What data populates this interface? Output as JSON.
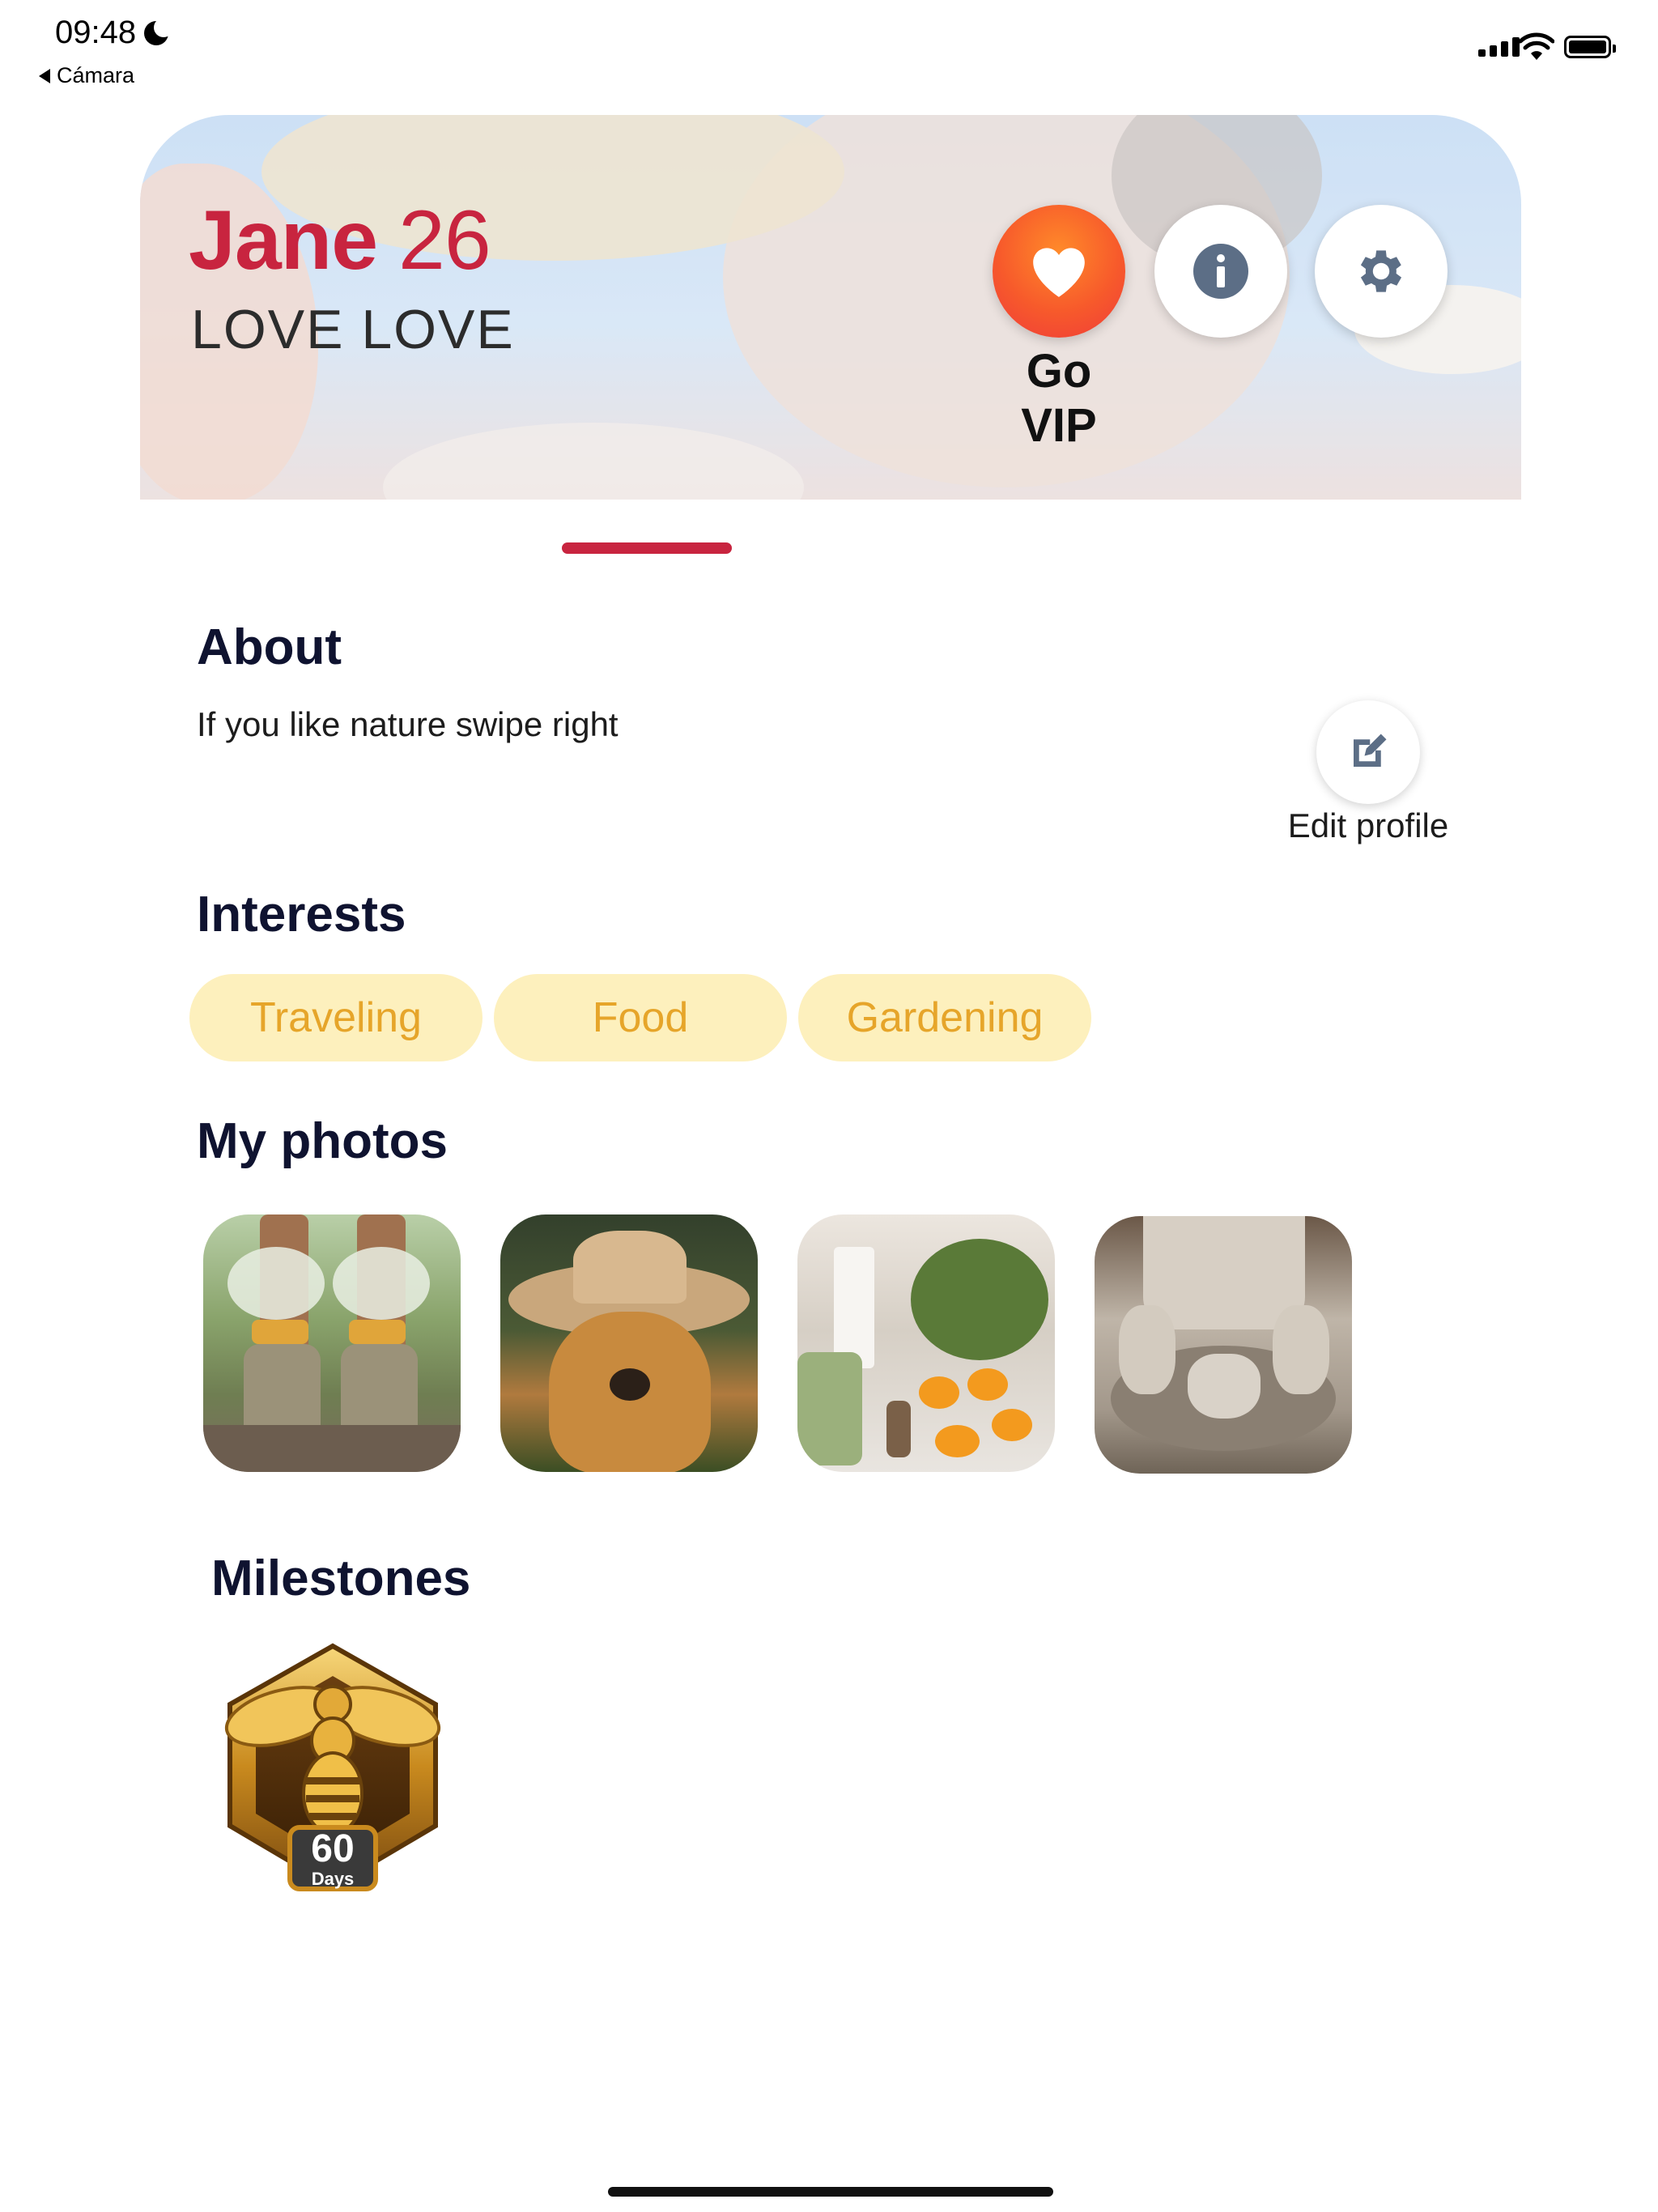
{
  "status_bar": {
    "time": "09:48",
    "back_app": "Cámara"
  },
  "profile": {
    "first_name": "Jane",
    "age": "26",
    "tagline": "LOVE LOVE"
  },
  "actions": {
    "vip_label": "Go VIP",
    "info_icon": "info-icon",
    "settings_icon": "gear-icon"
  },
  "about": {
    "title": "About",
    "text": "If you like nature swipe right",
    "edit_label": "Edit profile"
  },
  "interests": {
    "title": "Interests",
    "items": [
      "Traveling",
      "Food",
      "Gardening"
    ]
  },
  "photos": {
    "title": "My photos"
  },
  "milestones": {
    "title": "Milestones",
    "badge_number": "60",
    "badge_unit": "Days"
  },
  "colors": {
    "accent": "#c8243f",
    "pill_bg": "#fdf0bd",
    "pill_text": "#e6a52a",
    "heading": "#0f1330"
  }
}
